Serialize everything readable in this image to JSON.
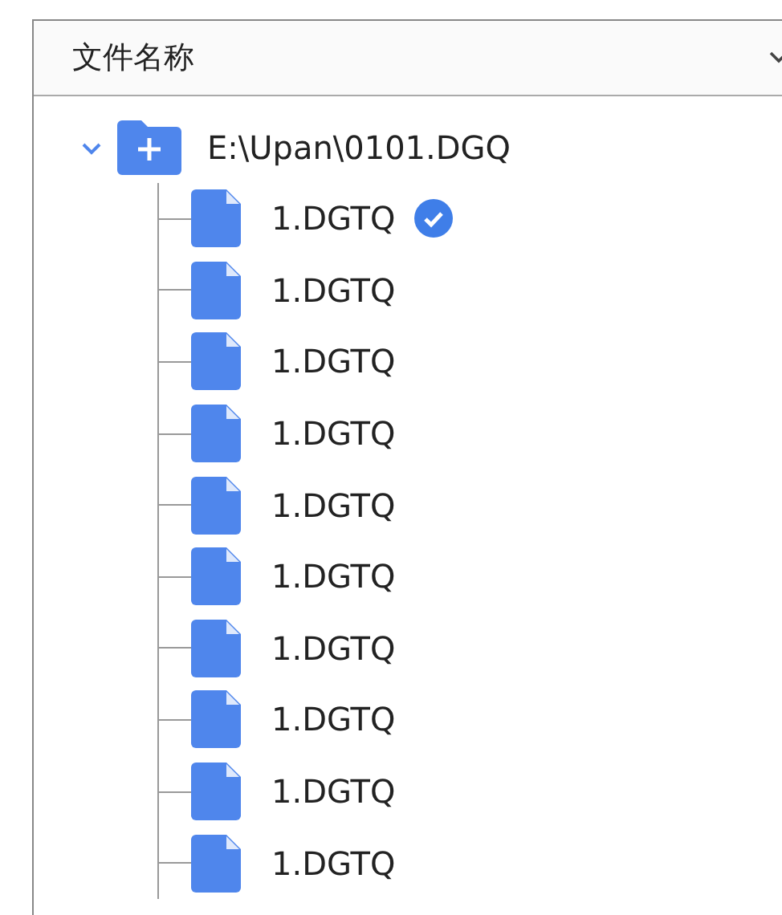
{
  "header": {
    "title": "文件名称"
  },
  "tree": {
    "label": "E:\\Upan\\0101.DGQ",
    "expanded": true,
    "children": [
      {
        "label": "1.DGTQ",
        "checked": true
      },
      {
        "label": "1.DGTQ",
        "checked": false
      },
      {
        "label": "1.DGTQ",
        "checked": false
      },
      {
        "label": "1.DGTQ",
        "checked": false
      },
      {
        "label": "1.DGTQ",
        "checked": false
      },
      {
        "label": "1.DGTQ",
        "checked": false
      },
      {
        "label": "1.DGTQ",
        "checked": false
      },
      {
        "label": "1.DGTQ",
        "checked": false
      },
      {
        "label": "1.DGTQ",
        "checked": false
      },
      {
        "label": "1.DGTQ",
        "checked": false
      }
    ]
  }
}
